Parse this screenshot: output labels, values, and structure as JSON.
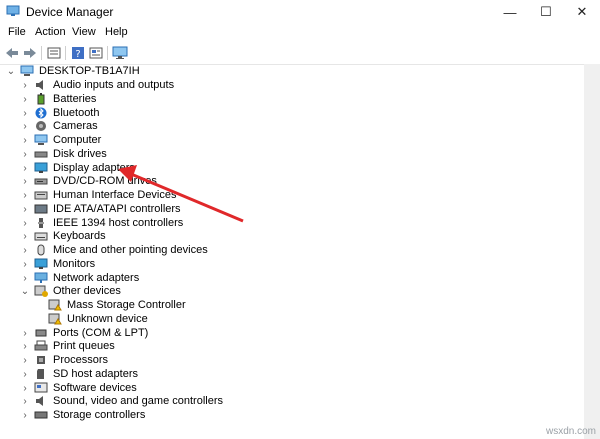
{
  "window": {
    "title": "Device Manager",
    "minimize": "—",
    "maximize": "☐",
    "close": "✕"
  },
  "menu": [
    "File",
    "Action",
    "View",
    "Help"
  ],
  "toolbar": [
    "back-icon",
    "forward-icon",
    "properties-icon",
    "help-icon",
    "show-hidden-icon",
    "monitor-icon"
  ],
  "tree": {
    "root": "DESKTOP-TB1A7IH",
    "categories": [
      {
        "label": "Audio inputs and outputs",
        "icon": "speaker-icon"
      },
      {
        "label": "Batteries",
        "icon": "battery-icon"
      },
      {
        "label": "Bluetooth",
        "icon": "bluetooth-icon"
      },
      {
        "label": "Cameras",
        "icon": "camera-icon"
      },
      {
        "label": "Computer",
        "icon": "computer-icon"
      },
      {
        "label": "Disk drives",
        "icon": "disk-icon"
      },
      {
        "label": "Display adapters",
        "icon": "display-icon"
      },
      {
        "label": "DVD/CD-ROM drives",
        "icon": "dvd-icon"
      },
      {
        "label": "Human Interface Devices",
        "icon": "hid-icon"
      },
      {
        "label": "IDE ATA/ATAPI controllers",
        "icon": "ide-icon"
      },
      {
        "label": "IEEE 1394 host controllers",
        "icon": "ieee-icon"
      },
      {
        "label": "Keyboards",
        "icon": "keyboard-icon"
      },
      {
        "label": "Mice and other pointing devices",
        "icon": "mouse-icon"
      },
      {
        "label": "Monitors",
        "icon": "monitor-icon"
      },
      {
        "label": "Network adapters",
        "icon": "network-icon"
      },
      {
        "label": "Other devices",
        "icon": "unknown-device-icon",
        "expanded": true,
        "children": [
          {
            "label": "Mass Storage Controller",
            "icon": "warning-device-icon"
          },
          {
            "label": "Unknown device",
            "icon": "warning-device-icon"
          }
        ]
      },
      {
        "label": "Ports (COM & LPT)",
        "icon": "port-icon"
      },
      {
        "label": "Print queues",
        "icon": "printer-icon"
      },
      {
        "label": "Processors",
        "icon": "processor-icon"
      },
      {
        "label": "SD host adapters",
        "icon": "sd-icon"
      },
      {
        "label": "Software devices",
        "icon": "software-icon"
      },
      {
        "label": "Sound, video and game controllers",
        "icon": "sound-icon"
      },
      {
        "label": "Storage controllers",
        "icon": "storage-icon"
      }
    ]
  },
  "watermark": "wsxdn.com",
  "colors": {
    "accent": "#2b78d6",
    "arrow": "#e0282a",
    "chevron": "#555555"
  }
}
